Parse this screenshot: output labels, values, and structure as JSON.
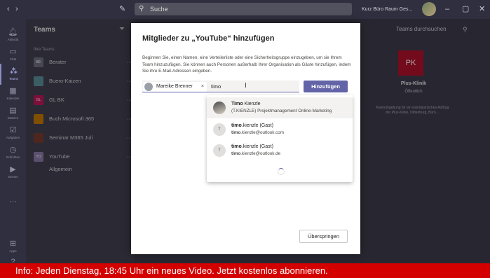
{
  "titlebar": {
    "search_placeholder": "Suche",
    "org_name": "Kurz Büro Raum Ges...",
    "back_icon": "back-arrow",
    "forward_icon": "forward-arrow",
    "compose_icon": "compose"
  },
  "rail": {
    "items": [
      {
        "label": "Aktivität",
        "icon": "bell"
      },
      {
        "label": "Chat",
        "icon": "chat"
      },
      {
        "label": "Teams",
        "icon": "teams"
      },
      {
        "label": "Kalender",
        "icon": "calendar"
      },
      {
        "label": "Dateien",
        "icon": "files"
      },
      {
        "label": "Aufgaben",
        "icon": "tasks"
      },
      {
        "label": "Schichten",
        "icon": "shifts"
      },
      {
        "label": "Stream",
        "icon": "stream"
      },
      {
        "label": "Apps",
        "icon": "apps"
      },
      {
        "label": "Hilfe",
        "icon": "help"
      }
    ]
  },
  "teams_panel": {
    "title": "Teams",
    "section": "Ihre Teams",
    "teams": [
      {
        "initials": "BE",
        "name": "Berater",
        "color": "#6f6f7f"
      },
      {
        "initials": "",
        "name": "Buero-Kaizen",
        "color": "#5b8f9a"
      },
      {
        "initials": "GL",
        "name": "GL BK",
        "color": "#c2185b"
      },
      {
        "initials": "",
        "name": "Buch Microsoft 365",
        "color": "#c77a00"
      },
      {
        "initials": "",
        "name": "Seminar M365 Juli",
        "color": "#7a3b2e"
      },
      {
        "initials": "YO",
        "name": "YouTube",
        "color": "#8a7aa8"
      }
    ],
    "channel": "Allgemein"
  },
  "right_panel": {
    "search_label": "Teams durchsuchen",
    "tile_initials": "PK",
    "tile_name": "Plus-Klinik",
    "tile_status": "Öffentlich",
    "tile_desc": "Teamumgebung für ein exemplarisches Auftrag der Plus-Klinik, Oldenburg, Büro..."
  },
  "dialog": {
    "title": "Mitglieder zu „YouTube“ hinzufügen",
    "description": "Beginnen Sie, einen Namen, eine Verteilerliste oder eine Sicherheitsgruppe einzugeben, um sie Ihrem Team hinzuzufügen. Sie können auch Personen außerhalb Ihrer Organisation als Gäste hinzufügen, indem Sie ihre E-Mail-Adressen eingeben.",
    "chip_name": "Mareike Brenner",
    "chip_remove": "×",
    "typed_text": "timo",
    "add_button": "Hinzufügen",
    "skip_button": "Überspringen",
    "suggestions": [
      {
        "initial": "",
        "name_bold": "Timo",
        "name_rest": " Kienzle",
        "detail_bold": "",
        "detail_rest": "(T.KIENZLE) Projektmanagement Online-Marketing"
      },
      {
        "initial": "T",
        "name_bold": "timo",
        "name_rest": ".kienzle (Gast)",
        "detail_bold": "timo",
        "detail_rest": ".kienzle@outlook.com"
      },
      {
        "initial": "T",
        "name_bold": "timo",
        "name_rest": ".kienzle (Gast)",
        "detail_bold": "timo",
        "detail_rest": ".kienzle@outlook.de"
      }
    ]
  },
  "banner": {
    "text": "Info: Jeden Dienstag, 18:45 Uhr ein neues Video. Jetzt kostenlos abonnieren.",
    "color": "#d40000"
  },
  "colors": {
    "accent": "#6264a7"
  }
}
